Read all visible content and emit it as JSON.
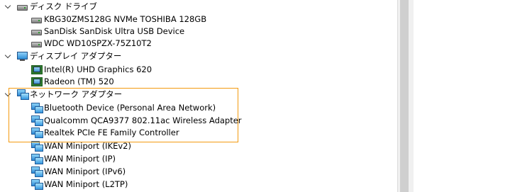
{
  "tree": {
    "categories": [
      {
        "label": "ディスク ドライブ",
        "icon": "disk-drive-icon",
        "devices": [
          {
            "label": "KBG30ZMS128G NVMe TOSHIBA 128GB",
            "icon": "disk-drive-icon"
          },
          {
            "label": "SanDisk SanDisk Ultra USB Device",
            "icon": "disk-drive-icon"
          },
          {
            "label": "WDC WD10SPZX-75Z10T2",
            "icon": "disk-drive-icon"
          }
        ]
      },
      {
        "label": "ディスプレイ アダプター",
        "icon": "display-adapter-category-icon",
        "devices": [
          {
            "label": "Intel(R) UHD Graphics 620",
            "icon": "display-adapter-icon"
          },
          {
            "label": "Radeon (TM) 520",
            "icon": "display-adapter-icon"
          }
        ]
      },
      {
        "label": "ネットワーク アダプター",
        "icon": "network-adapter-icon",
        "devices": [
          {
            "label": "Bluetooth Device (Personal Area Network)",
            "icon": "network-adapter-icon"
          },
          {
            "label": "Qualcomm QCA9377 802.11ac Wireless Adapter",
            "icon": "network-adapter-icon"
          },
          {
            "label": "Realtek PCIe FE Family Controller",
            "icon": "network-adapter-icon"
          },
          {
            "label": "WAN Miniport (IKEv2)",
            "icon": "network-adapter-icon"
          },
          {
            "label": "WAN Miniport (IP)",
            "icon": "network-adapter-icon"
          },
          {
            "label": "WAN Miniport (IPv6)",
            "icon": "network-adapter-icon"
          },
          {
            "label": "WAN Miniport (L2TP)",
            "icon": "network-adapter-icon"
          }
        ]
      }
    ]
  },
  "highlight": {
    "color": "#f39a10"
  }
}
